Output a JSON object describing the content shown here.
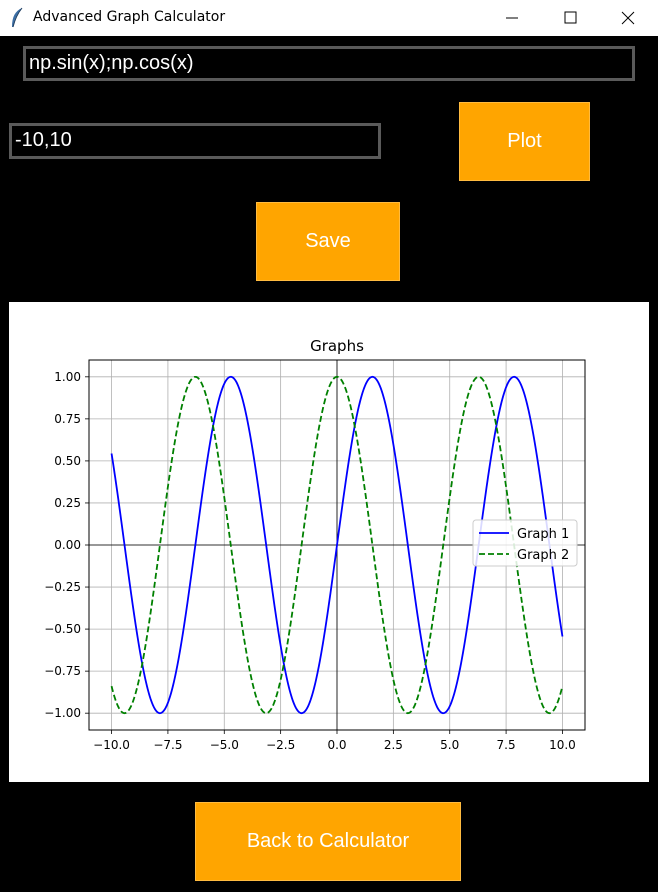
{
  "window": {
    "title": "Advanced Graph Calculator",
    "icon": "feather-icon"
  },
  "inputs": {
    "expression_value": "np.sin(x);np.cos(x)",
    "range_value": "-10,10"
  },
  "buttons": {
    "plot_label": "Plot",
    "save_label": "Save",
    "back_label": "Back to Calculator"
  },
  "colors": {
    "button_bg": "#ffa500",
    "background": "#000000",
    "series1": "#0000ff",
    "series2": "#008000"
  },
  "chart_data": {
    "type": "line",
    "title": "Graphs",
    "xlabel": "",
    "ylabel": "",
    "xlim": [
      -11,
      11
    ],
    "ylim": [
      -1.1,
      1.1
    ],
    "x_range": [
      -10,
      10
    ],
    "xticks": [
      "−10.0",
      "−7.5",
      "−5.0",
      "−2.5",
      "0.0",
      "2.5",
      "5.0",
      "7.5",
      "10.0"
    ],
    "xtick_values": [
      -10,
      -7.5,
      -5,
      -2.5,
      0,
      2.5,
      5,
      7.5,
      10
    ],
    "yticks": [
      "1.00",
      "0.75",
      "0.50",
      "0.25",
      "0.00",
      "−0.25",
      "−0.50",
      "−0.75",
      "−1.00"
    ],
    "ytick_values": [
      1,
      0.75,
      0.5,
      0.25,
      0,
      -0.25,
      -0.5,
      -0.75,
      -1
    ],
    "grid": true,
    "axes_lines_at_zero": true,
    "legend": "center-right",
    "series": [
      {
        "name": "Graph 1",
        "function": "sin",
        "style": "solid",
        "color": "#0000ff"
      },
      {
        "name": "Graph 2",
        "function": "cos",
        "style": "dashed",
        "color": "#008000"
      }
    ]
  }
}
